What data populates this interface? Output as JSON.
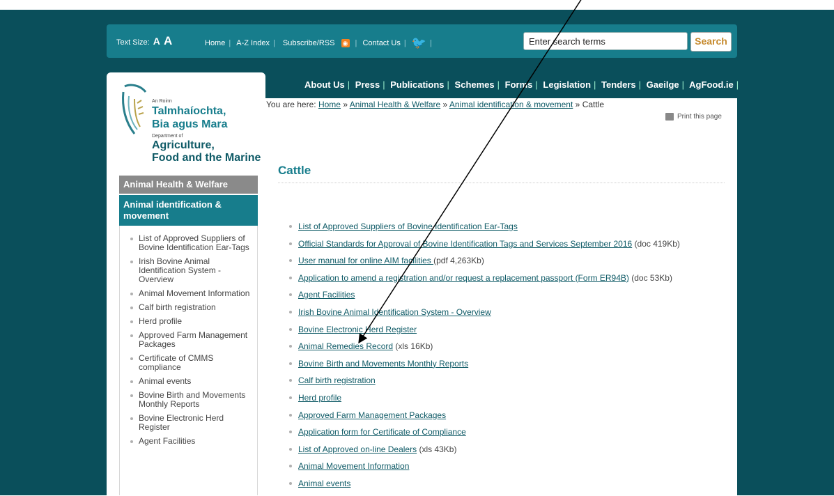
{
  "topbar": {
    "text_size_label": "Text Size:",
    "text_size_small": "A",
    "text_size_large": "A",
    "links": [
      "Home",
      "A-Z Index",
      "Subscribe/RSS",
      "Contact Us"
    ],
    "search_placeholder": "Enter search terms",
    "search_button": "Search"
  },
  "logo": {
    "an_roinn": "An Roinn",
    "irish_line1": "Talmhaíochta,",
    "irish_line2": "Bia agus Mara",
    "department_of": "Department of",
    "english_line1": "Agriculture,",
    "english_line2": "Food and the Marine"
  },
  "top_nav": [
    "About Us",
    "Press",
    "Publications",
    "Schemes",
    "Forms",
    "Legislation",
    "Tenders",
    "Gaeilge",
    "AgFood.ie"
  ],
  "breadcrumb": {
    "prefix": "You are here:",
    "links": [
      "Home",
      "Animal Health & Welfare",
      "Animal identification & movement"
    ],
    "separator": "»",
    "current": "Cattle"
  },
  "print_label": "Print this page",
  "sidebar": {
    "section": "Animal Health & Welfare",
    "subsection": "Animal identification & movement",
    "items": [
      "List of Approved Suppliers of Bovine Identification Ear-Tags",
      "Irish Bovine Animal Identification System - Overview",
      "Animal Movement Information",
      "Calf birth registration",
      "Herd profile",
      "Approved Farm Management Packages",
      "Certificate of CMMS compliance",
      "Animal events",
      "Bovine Birth and Movements Monthly Reports",
      "Bovine Electronic Herd Register",
      "Agent Facilities"
    ]
  },
  "page_title": "Cattle",
  "content_links": [
    {
      "text": "List of Approved Suppliers of Bovine Identification Ear-Tags",
      "note": ""
    },
    {
      "text": "Official Standards for Approval of Bovine Identification Tags and Services September 2016",
      "note": " (doc 419Kb)"
    },
    {
      "text": "User manual for online AIM facilities ",
      "note": "(pdf 4,263Kb)"
    },
    {
      "text": "Application to amend a registration and/or request a replacement passport (Form ER94B)",
      "note": " (doc 53Kb)"
    },
    {
      "text": "Agent Facilities",
      "note": ""
    },
    {
      "text": "Irish Bovine Animal Identification System - Overview",
      "note": ""
    },
    {
      "text": "Bovine Electronic Herd Register",
      "note": ""
    },
    {
      "text": "Animal Remedies Record",
      "note": " (xls 16Kb)"
    },
    {
      "text": "Bovine Birth and Movements Monthly Reports",
      "note": ""
    },
    {
      "text": "Calf birth registration",
      "note": ""
    },
    {
      "text": "Herd profile",
      "note": ""
    },
    {
      "text": "Approved Farm Management Packages",
      "note": ""
    },
    {
      "text": "Application form for Certificate of Compliance",
      "note": ""
    },
    {
      "text": "List of Approved on-line Dealers",
      "note": " (xls 43Kb)"
    },
    {
      "text": "Animal Movement Information",
      "note": ""
    },
    {
      "text": "Animal events",
      "note": ""
    }
  ],
  "colors": {
    "brand_teal": "#177d8c",
    "dark_teal_background": "#0a4f5b",
    "sidebar_section_gray": "#8a8a8a"
  },
  "icons": [
    "rss-icon",
    "twitter-icon",
    "printer-icon",
    "department-logo-icon"
  ]
}
